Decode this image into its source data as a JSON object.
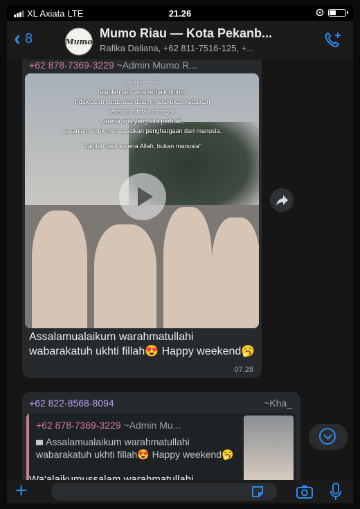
{
  "status_bar": {
    "carrier": "XL Axiata",
    "network": "LTE",
    "time": "21.26"
  },
  "header": {
    "back_count": "8",
    "title": "Mumo Riau — Kota Pekanb...",
    "subtitle": "Rafika Daliana, +62 811-7516-125, +...",
    "avatar_logo": "Mumo"
  },
  "messages": [
    {
      "sender": "+62 878-7369-3229",
      "sender_tag": "~Admin Mumo R...",
      "media": {
        "type": "video",
        "watermark": "@mumo_riau",
        "overlay_lines": [
          "Tetaplah jadi versi terbaik dirimu.",
          "Tidak usah putus asa dalam melakukan kebaikan",
          "walaupun tidak dihargai.",
          "Karena apa yang kita perbuat,",
          "bukanlah untuk mendapatkan penghargaan dari manusia.",
          "\"Jadilah baik karena Allah, bukan manusia\""
        ]
      },
      "caption": "Assalamualaikum warahmatullahi wabarakatuh ukhti fillah😍 Happy weekend🥱",
      "time": "07.28"
    },
    {
      "sender": "+62 822-8568-8094",
      "sender_tag": "~Kha_",
      "quoted": {
        "sender": "+62 878-7369-3229",
        "sender_tag": "~Admin Mu...",
        "text": "Assalamualaikum warahmatullahi wabarakatuh ukhti fillah😍 Happy weekend🥱"
      },
      "partial_text": "Wa'alaikumussalam warahmatullahi"
    }
  ],
  "input": {
    "placeholder": ""
  },
  "colors": {
    "accent": "#2d8cf0",
    "sender_name": "#cc7b9b",
    "bubble": "#262a2c"
  }
}
